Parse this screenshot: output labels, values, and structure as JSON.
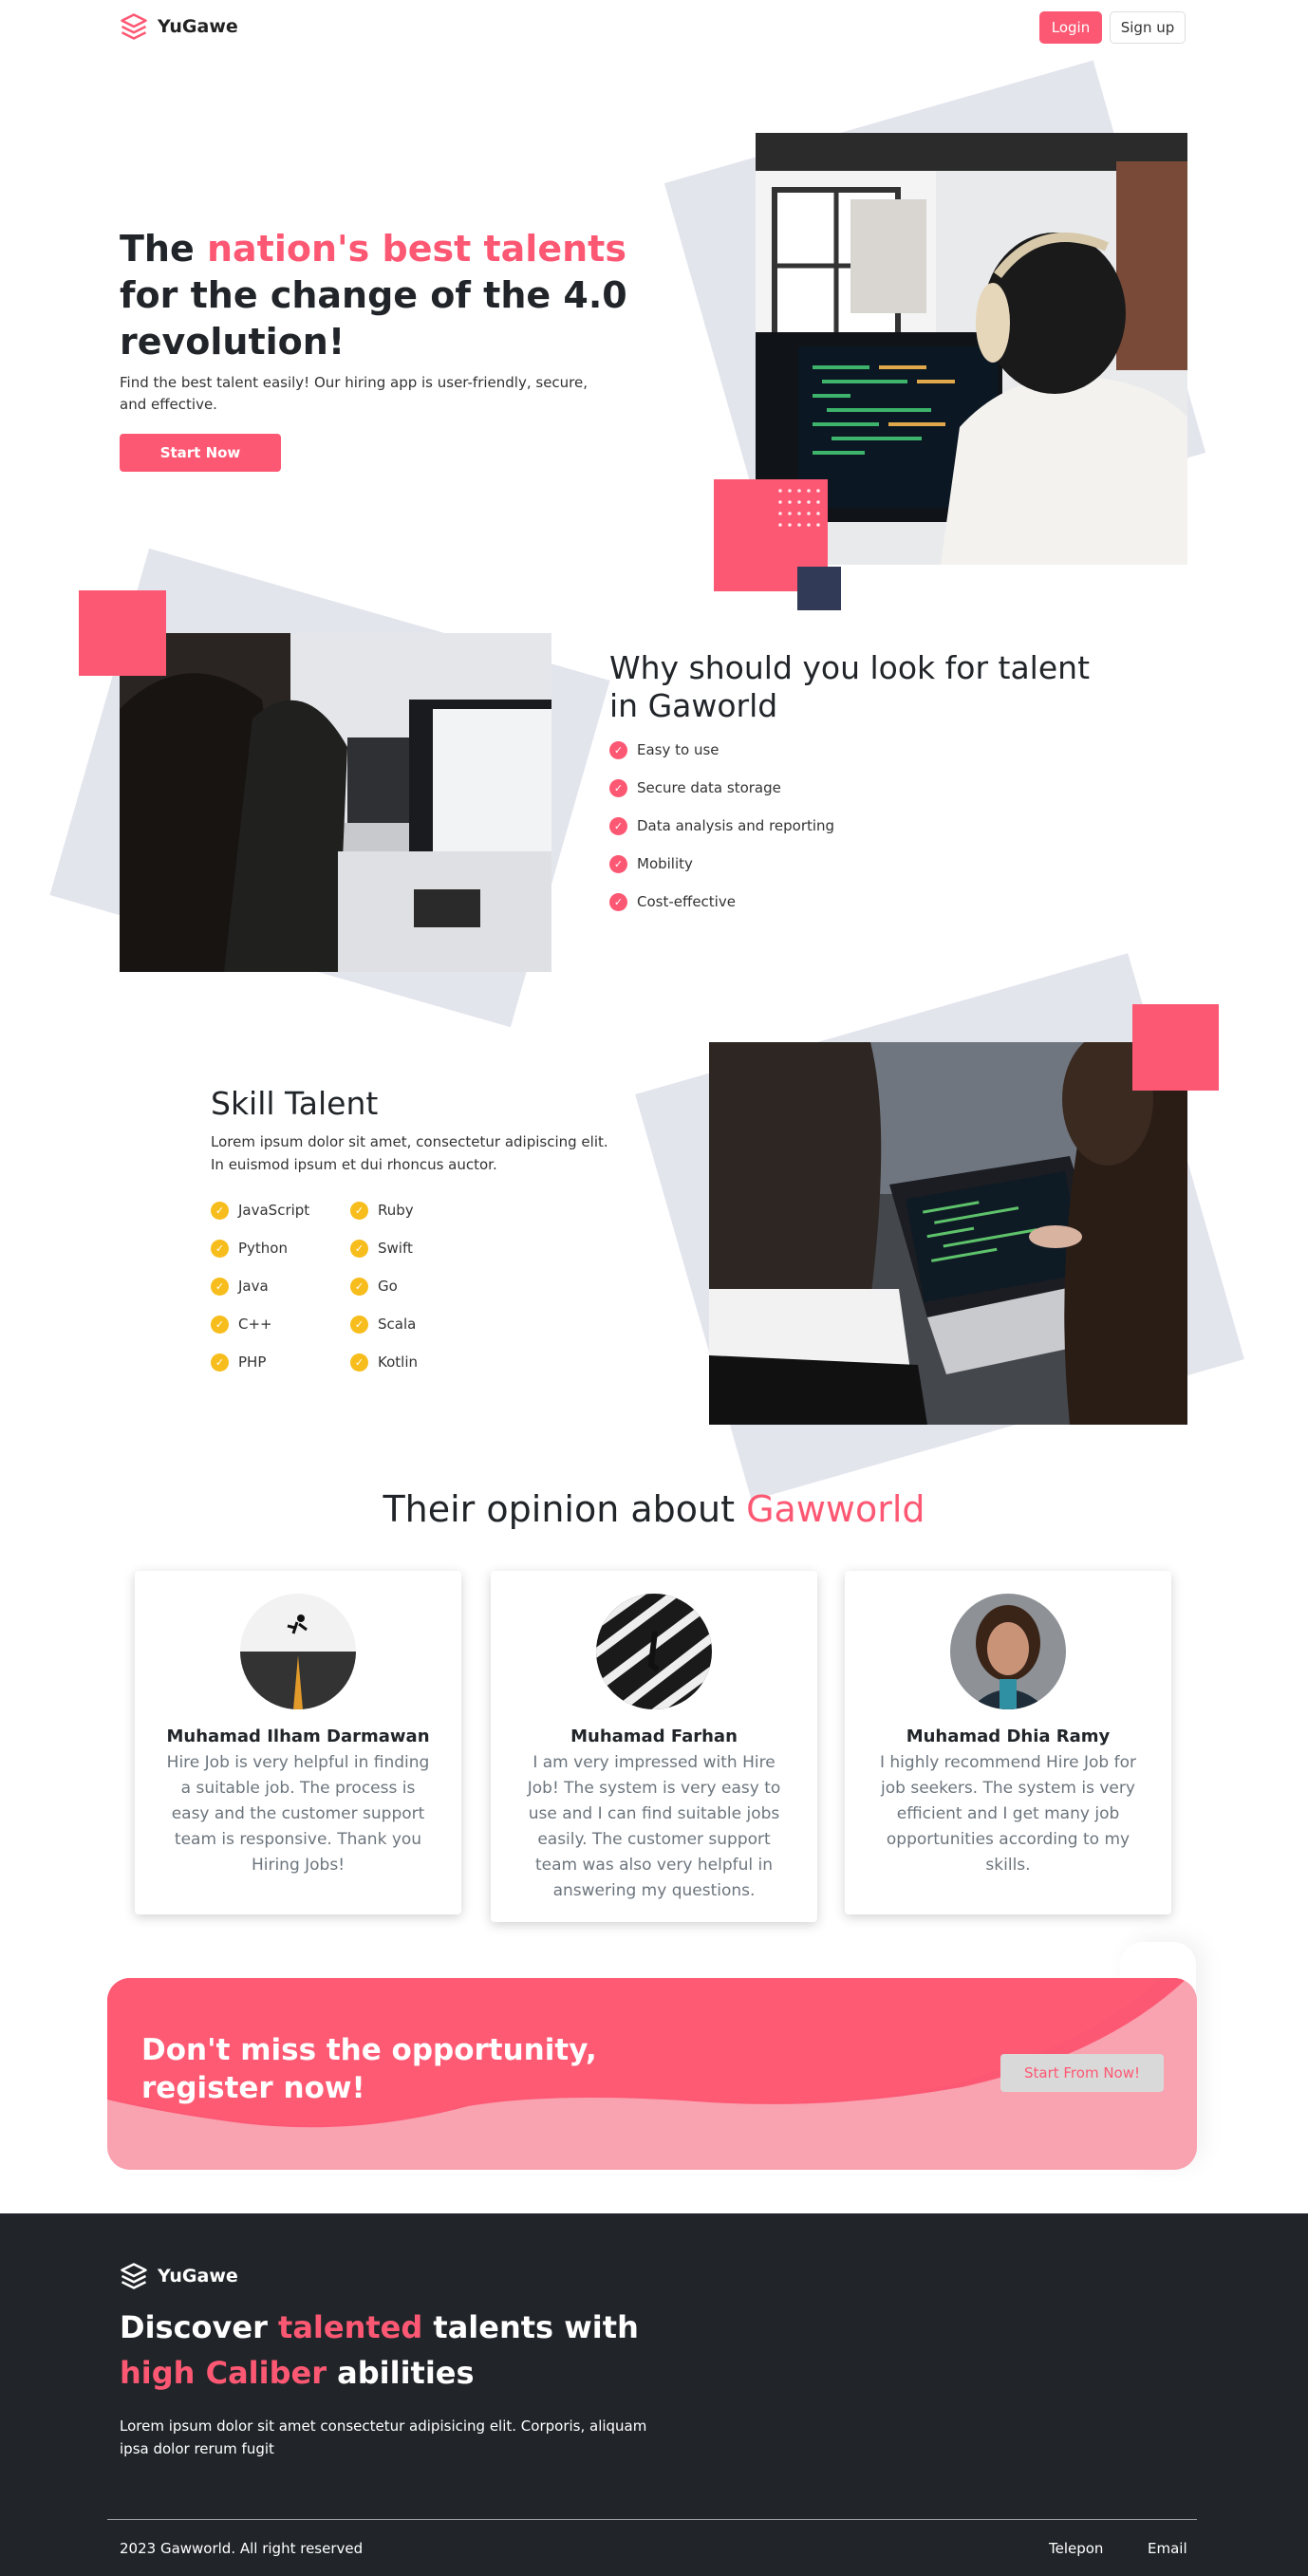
{
  "nav": {
    "brand": "YuGawe",
    "login": "Login",
    "signup": "Sign up"
  },
  "hero": {
    "title_pre": "The ",
    "title_highlight": "nation's best talents",
    "title_post": " for the change of the 4.0 revolution!",
    "subtitle": "Find the best talent easily! Our hiring app is user-friendly, secure, and effective.",
    "cta": "Start Now"
  },
  "why": {
    "title": "Why should you look for talent in Gaworld",
    "items": [
      "Easy to use",
      "Secure data storage",
      "Data analysis and reporting",
      "Mobility",
      "Cost-effective"
    ]
  },
  "skill": {
    "title": "Skill Talent",
    "desc": "Lorem ipsum dolor sit amet, consectetur adipiscing elit. In euismod ipsum et dui rhoncus auctor.",
    "col1": [
      "JavaScript",
      "Python",
      "Java",
      "C++",
      "PHP"
    ],
    "col2": [
      "Ruby",
      "Swift",
      "Go",
      "Scala",
      "Kotlin"
    ]
  },
  "opinion": {
    "title_pre": "Their opinion about ",
    "title_highlight": "Gawworld",
    "cards": [
      {
        "name": "Muhamad Ilham Darmawan",
        "quote": "Hire Job is very helpful in finding a suitable job. The process is easy and the customer support team is responsive. Thank you Hiring Jobs!"
      },
      {
        "name": "Muhamad Farhan",
        "quote": "I am very impressed with Hire Job! The system is very easy to use and I can find suitable jobs easily. The customer support team was also very helpful in answering my questions."
      },
      {
        "name": "Muhamad Dhia Ramy",
        "quote": "I highly recommend Hire Job for job seekers. The system is very efficient and I get many job opportunities according to my skills."
      }
    ]
  },
  "cta": {
    "text": "Don't miss the opportunity, register now!",
    "button": "Start From Now!"
  },
  "footer": {
    "brand": "YuGawe",
    "title_1": "Discover ",
    "title_hl1": "talented",
    "title_2": " talents with ",
    "title_hl2": "high Caliber",
    "title_3": " abilities",
    "text": "Lorem ipsum dolor sit amet consectetur adipisicing elit. Corporis, aliquam ipsa dolor rerum fugit",
    "copyright": "2023 Gawworld. All right reserved",
    "link_phone": "Telepon",
    "link_email": "Email"
  },
  "colors": {
    "accent": "#fd5873",
    "check_yellow": "#f7bd1c",
    "footer_bg": "#212529",
    "navy": "#313a56"
  }
}
